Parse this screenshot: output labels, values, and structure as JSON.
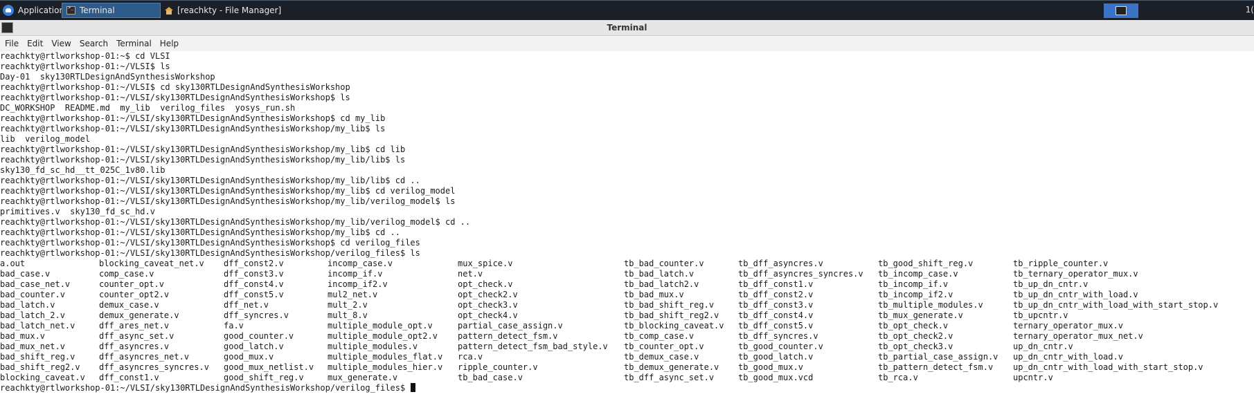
{
  "taskbar": {
    "applications_label": "Applications",
    "tasks": [
      {
        "label": "Terminal"
      },
      {
        "label": "[reachkty - File Manager]"
      }
    ],
    "clock": "1("
  },
  "window": {
    "title": "Terminal"
  },
  "menu": [
    "File",
    "Edit",
    "View",
    "Search",
    "Terminal",
    "Help"
  ],
  "terminal": {
    "lines": [
      "reachkty@rtlworkshop-01:~$ cd VLSI",
      "reachkty@rtlworkshop-01:~/VLSI$ ls",
      "Day-01  sky130RTLDesignAndSynthesisWorkshop",
      "reachkty@rtlworkshop-01:~/VLSI$ cd sky130RTLDesignAndSynthesisWorkshop",
      "reachkty@rtlworkshop-01:~/VLSI/sky130RTLDesignAndSynthesisWorkshop$ ls",
      "DC_WORKSHOP  README.md  my_lib  verilog_files  yosys_run.sh",
      "reachkty@rtlworkshop-01:~/VLSI/sky130RTLDesignAndSynthesisWorkshop$ cd my_lib",
      "reachkty@rtlworkshop-01:~/VLSI/sky130RTLDesignAndSynthesisWorkshop/my_lib$ ls",
      "lib  verilog_model",
      "reachkty@rtlworkshop-01:~/VLSI/sky130RTLDesignAndSynthesisWorkshop/my_lib$ cd lib",
      "reachkty@rtlworkshop-01:~/VLSI/sky130RTLDesignAndSynthesisWorkshop/my_lib/lib$ ls",
      "sky130_fd_sc_hd__tt_025C_1v80.lib",
      "reachkty@rtlworkshop-01:~/VLSI/sky130RTLDesignAndSynthesisWorkshop/my_lib/lib$ cd ..",
      "reachkty@rtlworkshop-01:~/VLSI/sky130RTLDesignAndSynthesisWorkshop/my_lib$ cd verilog_model",
      "reachkty@rtlworkshop-01:~/VLSI/sky130RTLDesignAndSynthesisWorkshop/my_lib/verilog_model$ ls",
      "primitives.v  sky130_fd_sc_hd.v",
      "reachkty@rtlworkshop-01:~/VLSI/sky130RTLDesignAndSynthesisWorkshop/my_lib/verilog_model$ cd ..",
      "reachkty@rtlworkshop-01:~/VLSI/sky130RTLDesignAndSynthesisWorkshop/my_lib$ cd ..",
      "reachkty@rtlworkshop-01:~/VLSI/sky130RTLDesignAndSynthesisWorkshop$ cd verilog_files",
      "reachkty@rtlworkshop-01:~/VLSI/sky130RTLDesignAndSynthesisWorkshop/verilog_files$ ls"
    ],
    "listing_columns": [
      [
        "a.out",
        "bad_case.v",
        "bad_case_net.v",
        "bad_counter.v",
        "bad_latch.v",
        "bad_latch_2.v",
        "bad_latch_net.v",
        "bad_mux.v",
        "bad_mux_net.v",
        "bad_shift_reg.v",
        "bad_shift_reg2.v",
        "blocking_caveat.v"
      ],
      [
        "blocking_caveat_net.v",
        "comp_case.v",
        "counter_opt.v",
        "counter_opt2.v",
        "demux_case.v",
        "demux_generate.v",
        "dff_ares_net.v",
        "dff_async_set.v",
        "dff_asyncres.v",
        "dff_asyncres_net.v",
        "dff_asyncres_syncres.v",
        "dff_const1.v"
      ],
      [
        "dff_const2.v",
        "dff_const3.v",
        "dff_const4.v",
        "dff_const5.v",
        "dff_net.v",
        "dff_syncres.v",
        "fa.v",
        "good_counter.v",
        "good_latch.v",
        "good_mux.v",
        "good_mux_netlist.v",
        "good_shift_reg.v"
      ],
      [
        "incomp_case.v",
        "incomp_if.v",
        "incomp_if2.v",
        "mul2_net.v",
        "mult_2.v",
        "mult_8.v",
        "multiple_module_opt.v",
        "multiple_module_opt2.v",
        "multiple_modules.v",
        "multiple_modules_flat.v",
        "multiple_modules_hier.v",
        "mux_generate.v"
      ],
      [
        "mux_spice.v",
        "net.v",
        "opt_check.v",
        "opt_check2.v",
        "opt_check3.v",
        "opt_check4.v",
        "partial_case_assign.v",
        "pattern_detect_fsm.v",
        "pattern_detect_fsm_bad_style.v",
        "rca.v",
        "ripple_counter.v",
        "tb_bad_case.v"
      ],
      [
        "tb_bad_counter.v",
        "tb_bad_latch.v",
        "tb_bad_latch2.v",
        "tb_bad_mux.v",
        "tb_bad_shift_reg.v",
        "tb_bad_shift_reg2.v",
        "tb_blocking_caveat.v",
        "tb_comp_case.v",
        "tb_counter_opt.v",
        "tb_demux_case.v",
        "tb_demux_generate.v",
        "tb_dff_async_set.v"
      ],
      [
        "tb_dff_asyncres.v",
        "tb_dff_asyncres_syncres.v",
        "tb_dff_const1.v",
        "tb_dff_const2.v",
        "tb_dff_const3.v",
        "tb_dff_const4.v",
        "tb_dff_const5.v",
        "tb_dff_syncres.v",
        "tb_good_counter.v",
        "tb_good_latch.v",
        "tb_good_mux.v",
        "tb_good_mux.vcd"
      ],
      [
        "tb_good_shift_reg.v",
        "tb_incomp_case.v",
        "tb_incomp_if.v",
        "tb_incomp_if2.v",
        "tb_multiple_modules.v",
        "tb_mux_generate.v",
        "tb_opt_check.v",
        "tb_opt_check2.v",
        "tb_opt_check3.v",
        "tb_partial_case_assign.v",
        "tb_pattern_detect_fsm.v",
        "tb_rca.v"
      ],
      [
        "tb_ripple_counter.v",
        "tb_ternary_operator_mux.v",
        "tb_up_dn_cntr.v",
        "tb_up_dn_cntr_with_load.v",
        "tb_up_dn_cntr_with_load_with_start_stop.v",
        "tb_upcntr.v",
        "ternary_operator_mux.v",
        "ternary_operator_mux_net.v",
        "up_dn_cntr.v",
        "up_dn_cntr_with_load.v",
        "up_dn_cntr_with_load_with_start_stop.v",
        "upcntr.v"
      ]
    ],
    "final_prompt": "reachkty@rtlworkshop-01:~/VLSI/sky130RTLDesignAndSynthesisWorkshop/verilog_files$ "
  }
}
